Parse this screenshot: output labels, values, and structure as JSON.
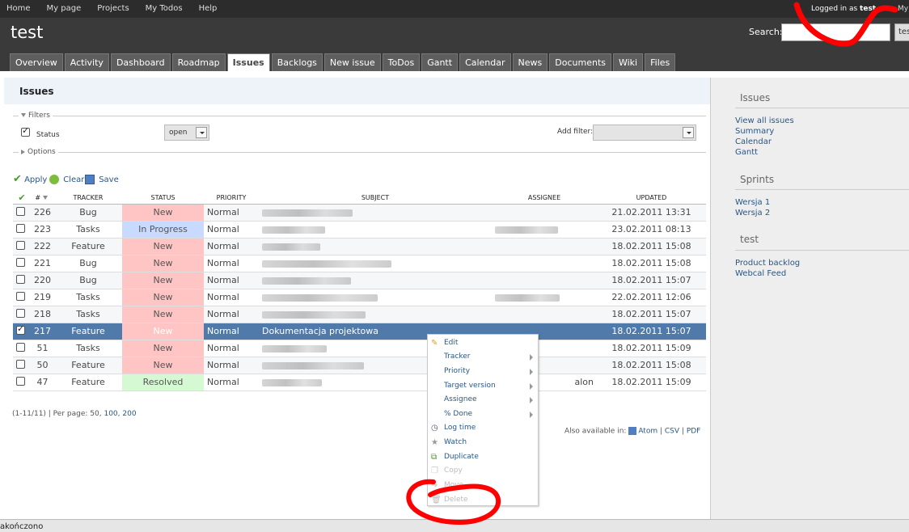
{
  "top_menu": {
    "items": [
      "Home",
      "My page",
      "Projects",
      "My Todos",
      "Help"
    ],
    "logged_in_prefix": "Logged in as",
    "user": "test",
    "right_stub": "My"
  },
  "header": {
    "title": "test",
    "search_label": "Search:",
    "search_value": "",
    "search_stub": "tes"
  },
  "tabs": [
    "Overview",
    "Activity",
    "Dashboard",
    "Roadmap",
    "Issues",
    "Backlogs",
    "New issue",
    "ToDos",
    "Gantt",
    "Calendar",
    "News",
    "Documents",
    "Wiki",
    "Files"
  ],
  "selected_tab": "Issues",
  "content": {
    "heading": "Issues",
    "filters_legend": "Filters",
    "status_filter_label": "Status",
    "status_filter_value": "open",
    "add_filter_label": "Add filter:",
    "options_legend": "Options",
    "apply": "Apply",
    "clear": "Clear",
    "save": "Save"
  },
  "table": {
    "headers": [
      "#",
      "TRACKER",
      "STATUS",
      "PRIORITY",
      "SUBJECT",
      "ASSIGNEE",
      "UPDATED"
    ],
    "rows": [
      {
        "id": "226",
        "tracker": "Bug",
        "status": "New",
        "priority": "Normal",
        "subject": "",
        "assignee": "",
        "updated": "21.02.2011 13:31"
      },
      {
        "id": "223",
        "tracker": "Tasks",
        "status": "In Progress",
        "priority": "Normal",
        "subject": "",
        "assignee": "",
        "updated": "23.02.2011 08:13"
      },
      {
        "id": "222",
        "tracker": "Feature",
        "status": "New",
        "priority": "Normal",
        "subject": "",
        "assignee": "",
        "updated": "18.02.2011 15:08"
      },
      {
        "id": "221",
        "tracker": "Bug",
        "status": "New",
        "priority": "Normal",
        "subject": "",
        "assignee": "",
        "updated": "18.02.2011 15:08"
      },
      {
        "id": "220",
        "tracker": "Bug",
        "status": "New",
        "priority": "Normal",
        "subject": "",
        "assignee": "",
        "updated": "18.02.2011 15:07"
      },
      {
        "id": "219",
        "tracker": "Tasks",
        "status": "New",
        "priority": "Normal",
        "subject": "",
        "assignee": "",
        "updated": "22.02.2011 12:06"
      },
      {
        "id": "218",
        "tracker": "Tasks",
        "status": "New",
        "priority": "Normal",
        "subject": "",
        "assignee": "",
        "updated": "18.02.2011 15:07"
      },
      {
        "id": "217",
        "tracker": "Feature",
        "status": "New",
        "priority": "Normal",
        "subject": "Dokumentacja projektowa",
        "assignee": "",
        "updated": "18.02.2011 15:07"
      },
      {
        "id": "51",
        "tracker": "Tasks",
        "status": "New",
        "priority": "Normal",
        "subject": "",
        "assignee": "",
        "updated": "18.02.2011 15:09"
      },
      {
        "id": "50",
        "tracker": "Feature",
        "status": "New",
        "priority": "Normal",
        "subject": "",
        "assignee": "",
        "updated": "18.02.2011 15:08"
      },
      {
        "id": "47",
        "tracker": "Feature",
        "status": "Resolved",
        "priority": "Normal",
        "subject": "",
        "assignee": "alon",
        "updated": "18.02.2011 15:09"
      }
    ]
  },
  "pager": {
    "summary": "(1-11/11) | Per page:",
    "options": [
      "50",
      "100",
      "200"
    ]
  },
  "also_available": {
    "label": "Also available in:",
    "formats": [
      "Atom",
      "CSV",
      "PDF"
    ]
  },
  "context_menu": {
    "items": [
      {
        "label": "Edit",
        "submenu": false,
        "disabled": false,
        "icon": "pencil-icon"
      },
      {
        "label": "Tracker",
        "submenu": true,
        "disabled": false,
        "icon": ""
      },
      {
        "label": "Priority",
        "submenu": true,
        "disabled": false,
        "icon": ""
      },
      {
        "label": "Target version",
        "submenu": true,
        "disabled": false,
        "icon": ""
      },
      {
        "label": "Assignee",
        "submenu": true,
        "disabled": false,
        "icon": ""
      },
      {
        "label": "% Done",
        "submenu": true,
        "disabled": false,
        "icon": ""
      },
      {
        "label": "Log time",
        "submenu": false,
        "disabled": false,
        "icon": "clock-icon"
      },
      {
        "label": "Watch",
        "submenu": false,
        "disabled": false,
        "icon": "star-icon"
      },
      {
        "label": "Duplicate",
        "submenu": false,
        "disabled": false,
        "icon": "duplicate-icon"
      },
      {
        "label": "Copy",
        "submenu": false,
        "disabled": true,
        "icon": "copy-icon"
      },
      {
        "label": "Move",
        "submenu": false,
        "disabled": true,
        "icon": "move-icon"
      },
      {
        "label": "Delete",
        "submenu": false,
        "disabled": true,
        "icon": "trash-icon"
      }
    ]
  },
  "sidebar": {
    "sections": [
      {
        "title": "Issues",
        "links": [
          "View all issues",
          "Summary",
          "Calendar",
          "Gantt"
        ]
      },
      {
        "title": "Sprints",
        "links": [
          "Wersja 1",
          "Wersja 2"
        ]
      },
      {
        "title": "test",
        "links": [
          "Product backlog",
          "Webcal Feed"
        ]
      }
    ]
  },
  "statusbar": {
    "text": "akończono"
  },
  "colors": {
    "status_new": "#ffc4c4",
    "status_in_progress": "#c8daff",
    "status_resolved": "#d5f9d2",
    "selected_row": "#507aaa",
    "annotation_red": "#ff0000"
  }
}
